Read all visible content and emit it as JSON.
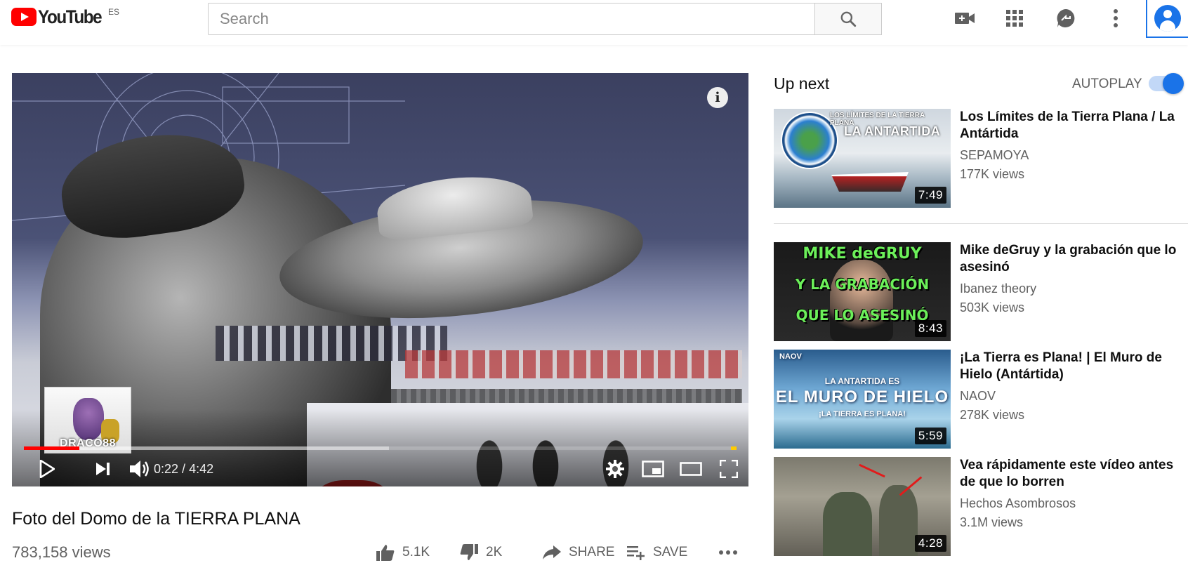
{
  "header": {
    "logo_text": "YouTube",
    "country_code": "ES",
    "search_placeholder": "Search",
    "icons": [
      "video-camera-icon",
      "apps-grid-icon",
      "messages-icon",
      "more-vert-icon",
      "account-icon"
    ]
  },
  "player": {
    "overlay_label": "DRACO88",
    "time_current": "0:22",
    "time_separator": " / ",
    "time_total": "4:42",
    "progress_played": 0.078,
    "progress_buffered": 0.512,
    "accent_color": "#ff0000"
  },
  "video": {
    "title": "Foto del Domo de la TIERRA PLANA",
    "views": "783,158 views",
    "likes": "5.1K",
    "dislikes": "2K",
    "share_label": "SHARE",
    "save_label": "SAVE"
  },
  "sidebar": {
    "up_next_label": "Up next",
    "autoplay_label": "AUTOPLAY",
    "autoplay_on": true,
    "videos": [
      {
        "title": "Los Límites de la Tierra Plana / La Antártida",
        "channel": "SEPAMOYA",
        "views": "177K views",
        "duration": "7:49",
        "thumb_caption_1": "LOS LÍMITES DE LA TIERRA PLANA",
        "thumb_caption_2": "LA ANTARTIDA"
      },
      {
        "title": "Mike deGruy y la grabación que lo asesinó",
        "channel": "Ibanez theory",
        "views": "503K views",
        "duration": "8:43",
        "thumb_caption_1": "MIKE deGRUY",
        "thumb_caption_2": "Y LA GRABACIÓN",
        "thumb_caption_3": "QUE LO ASESINÓ"
      },
      {
        "title": "¡La Tierra es Plana! | El Muro de Hielo (Antártida)",
        "channel": "NAOV",
        "views": "278K views",
        "duration": "5:59",
        "thumb_caption_1": "NAOV",
        "thumb_caption_2": "LA ANTARTIDA ES",
        "thumb_caption_3": "EL MURO DE HIELO",
        "thumb_caption_4": "¡LA TIERRA ES PLANA!"
      },
      {
        "title": "Vea rápidamente este vídeo antes de que lo borren",
        "channel": "Hechos Asombrosos",
        "views": "3.1M views",
        "duration": "4:28"
      }
    ]
  }
}
